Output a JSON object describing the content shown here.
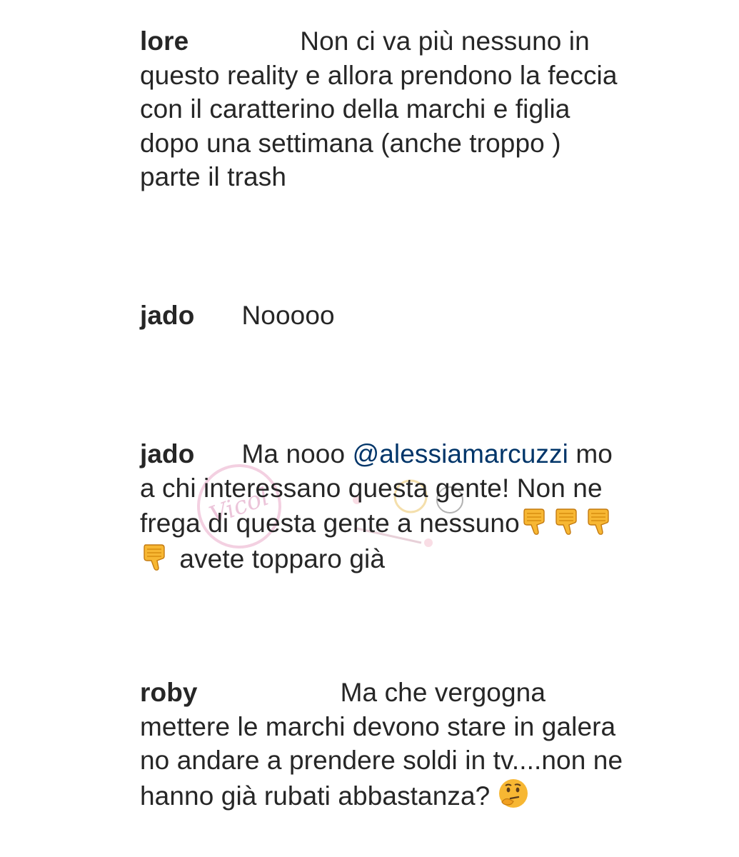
{
  "comments": [
    {
      "username": "lore",
      "text": "Non ci va più nessuno in questo reality e allora prendono la feccia con il caratterino della marchi e figlia dopo una settimana (anche troppo ) parte il trash"
    },
    {
      "username": "jado",
      "text": "Nooooo"
    },
    {
      "username": "jado",
      "text_before": "Ma nooo",
      "mention": "@alessiamarcuzzi",
      "text_middle": "mo a chi interessano questa gente! Non ne frega di questa gente a nessuno",
      "emoji": "thumbs-down-icon",
      "emoji_count": 4,
      "text_after": "avete topparo già"
    },
    {
      "username": "roby",
      "text": "Ma che vergogna mettere le marchi devono stare in galera no andare a prendere soldi in tv....non ne hanno già  rubati abbastanza?",
      "emoji": "thinking-face-icon"
    }
  ],
  "watermark": {
    "type": "logo",
    "text": "Vicol"
  },
  "colors": {
    "text": "#262626",
    "mention": "#003569",
    "emoji": "#F7B733",
    "background": "#ffffff"
  }
}
